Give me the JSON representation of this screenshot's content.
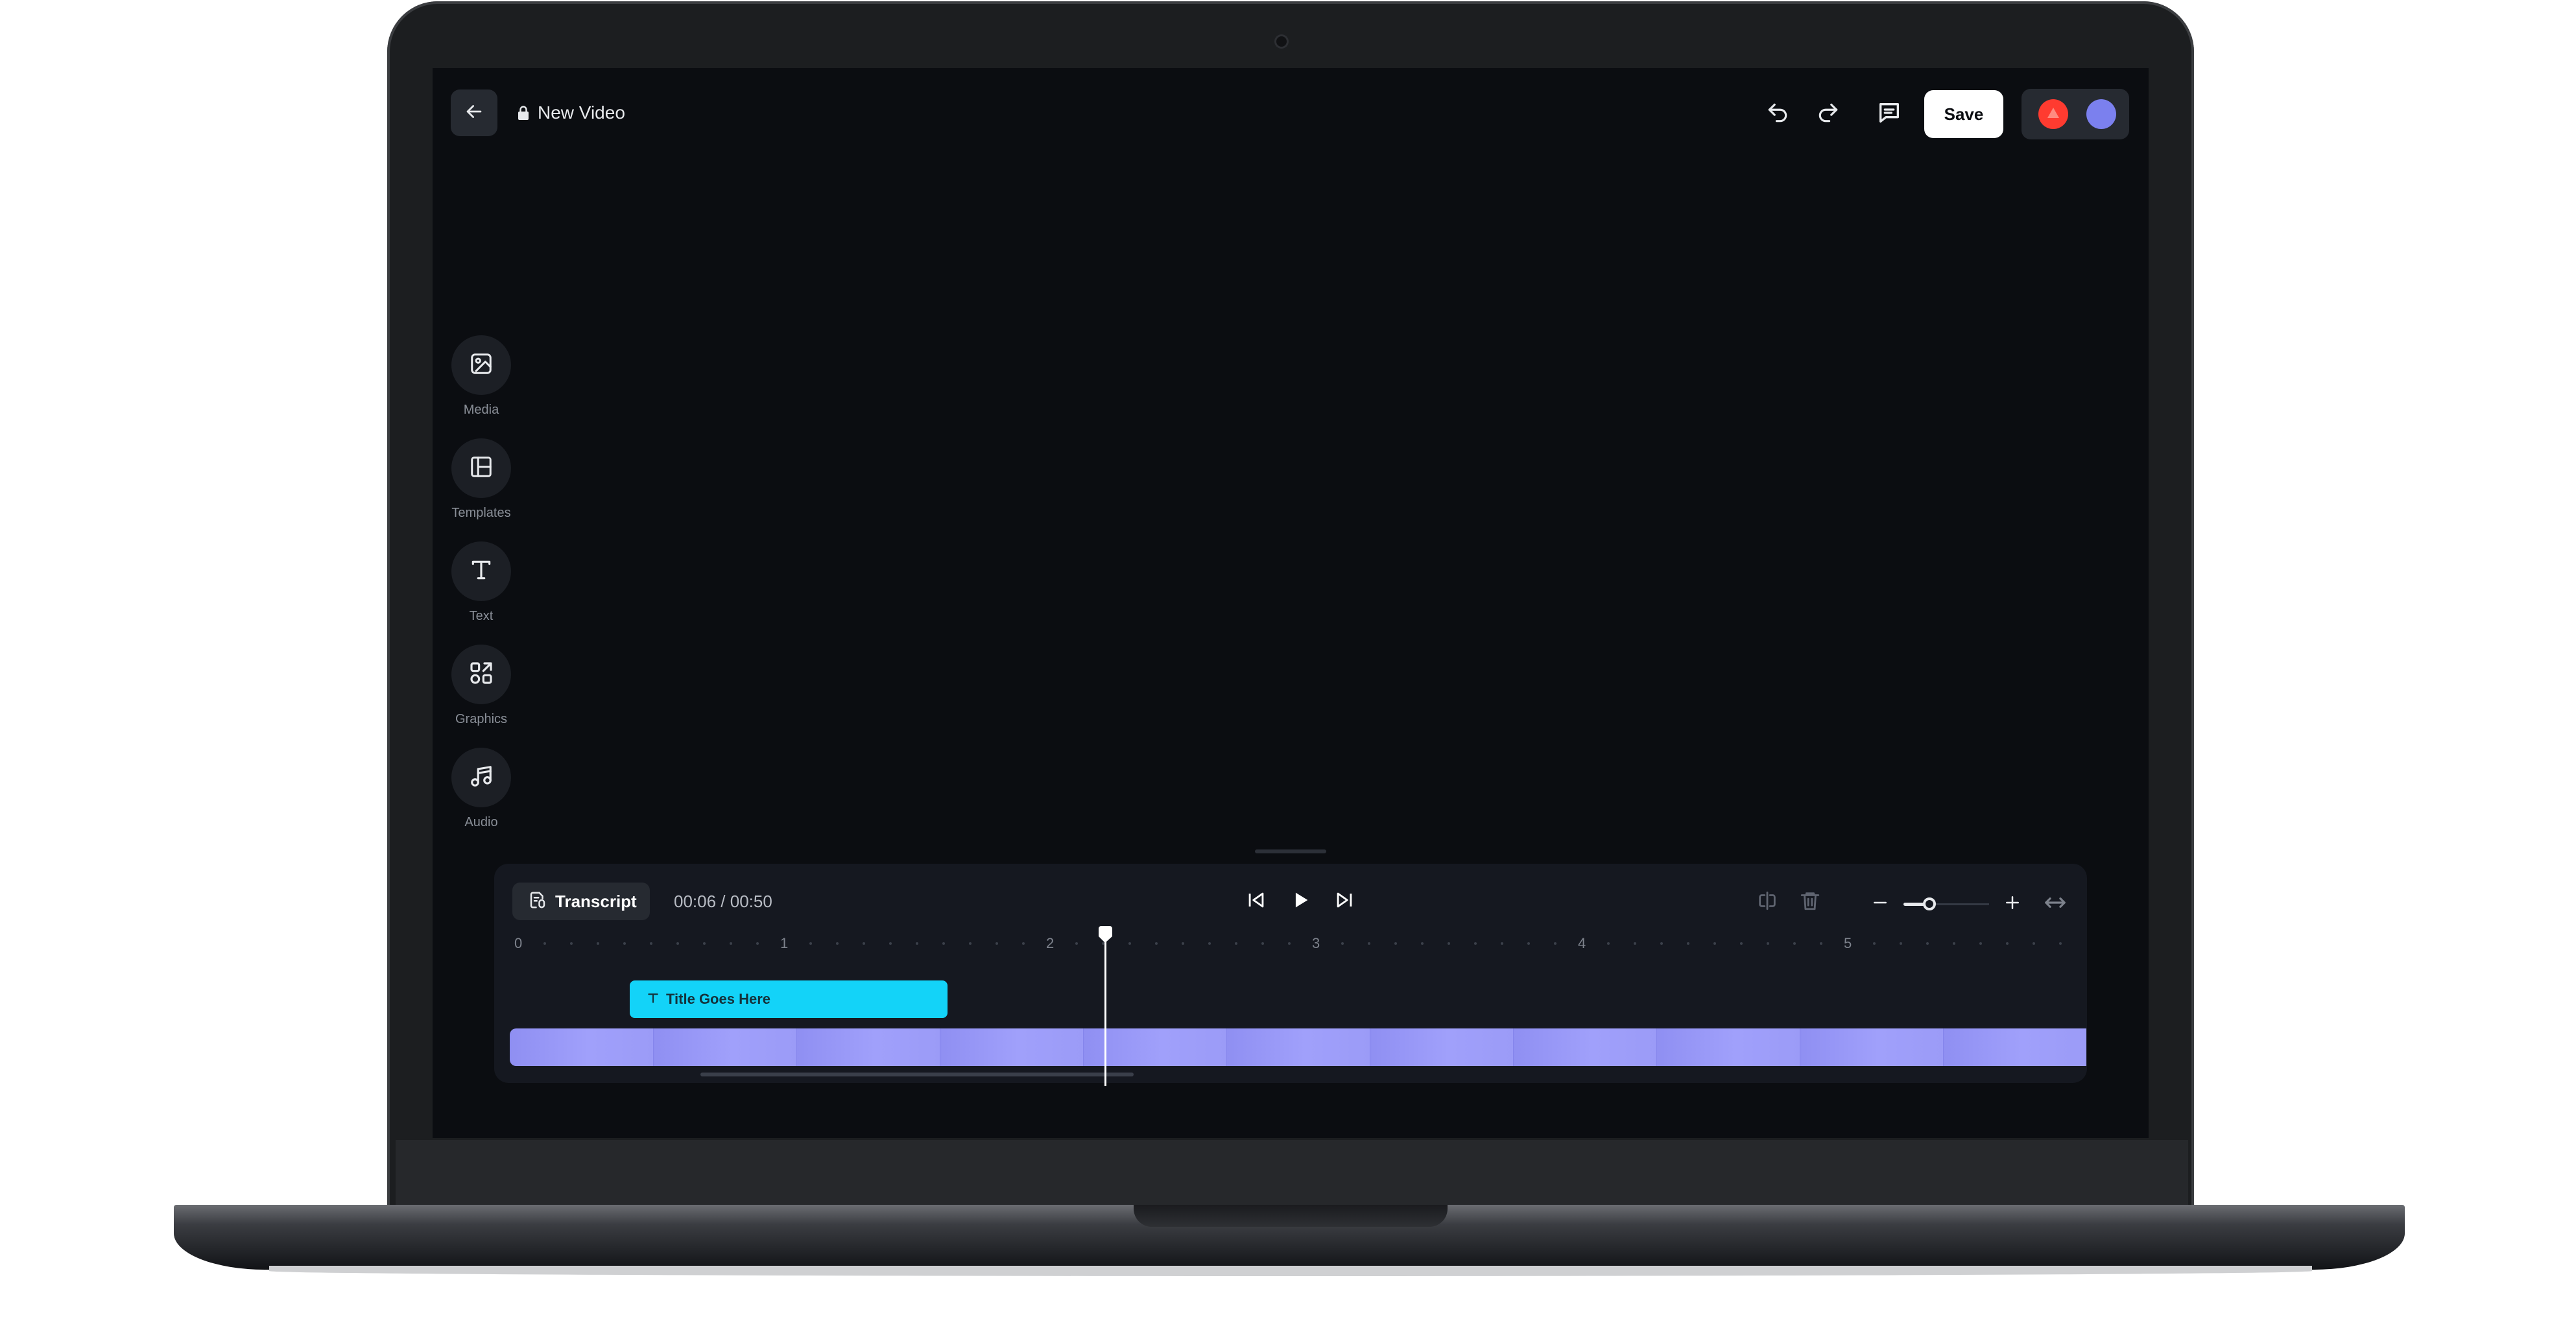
{
  "editor": {
    "title": "New Video",
    "save_label": "Save",
    "icons": {
      "back": "arrow-left-icon",
      "lock": "lock-icon",
      "undo": "undo-icon",
      "redo": "redo-icon",
      "comments": "comment-icon"
    },
    "avatar_colors": [
      "#ff3b30",
      "#7b80ee"
    ]
  },
  "sidebar": {
    "tools": [
      {
        "id": "media",
        "label": "Media",
        "icon": "image-icon"
      },
      {
        "id": "templates",
        "label": "Templates",
        "icon": "layout-icon"
      },
      {
        "id": "text",
        "label": "Text",
        "icon": "text-icon"
      },
      {
        "id": "graphics",
        "label": "Graphics",
        "icon": "shapes-icon"
      },
      {
        "id": "audio",
        "label": "Audio",
        "icon": "music-icon"
      }
    ]
  },
  "timeline": {
    "transcript_label": "Transcript",
    "timecode": "00:06 / 00:50",
    "ruler_labels": [
      "0",
      "1",
      "2",
      "3",
      "4",
      "5"
    ],
    "text_clip_label": "Title Goes Here",
    "zoom_level": 0.3,
    "colors": {
      "text_clip": "#13d3f8",
      "video_track": "#9b9bf7"
    }
  }
}
